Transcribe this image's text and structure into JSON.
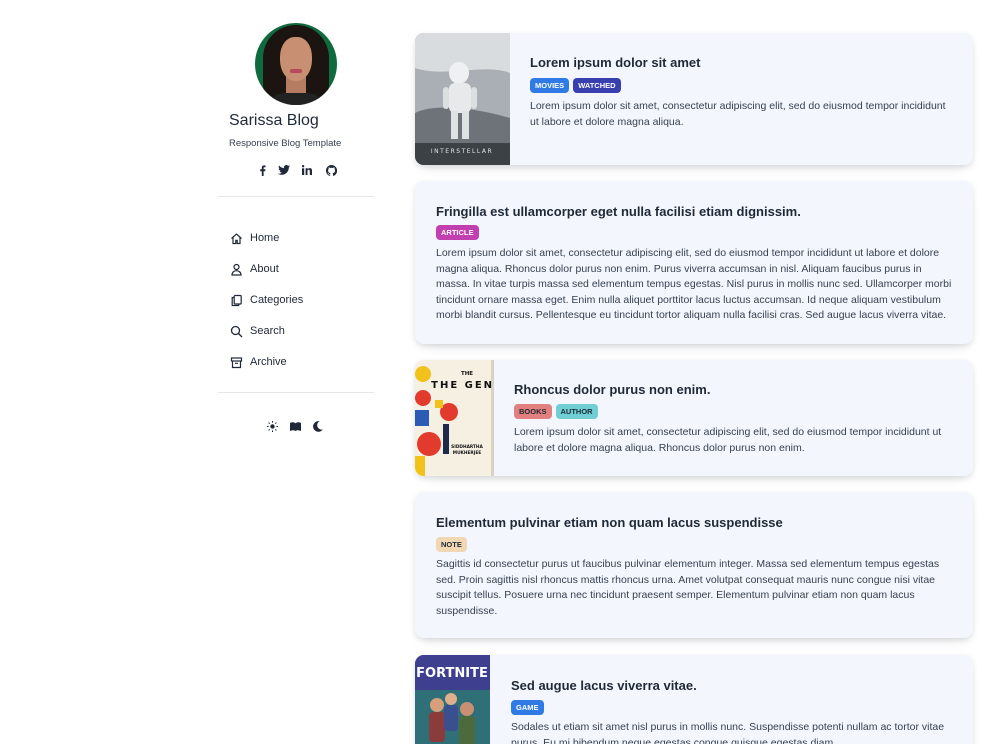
{
  "profile": {
    "name": "Sarissa Blog",
    "subtitle": "Responsive Blog Template",
    "avatar_icon": "person-avatar"
  },
  "socials": [
    {
      "name": "facebook-icon",
      "glyph": "f"
    },
    {
      "name": "twitter-icon",
      "glyph": "t"
    },
    {
      "name": "linkedin-icon",
      "glyph": "in"
    },
    {
      "name": "github-icon",
      "glyph": "gh"
    }
  ],
  "nav": {
    "items": [
      {
        "label": "Home",
        "icon": "home-icon"
      },
      {
        "label": "About",
        "icon": "user-icon"
      },
      {
        "label": "Categories",
        "icon": "copy-icon"
      },
      {
        "label": "Search",
        "icon": "search-icon"
      },
      {
        "label": "Archive",
        "icon": "archive-icon"
      }
    ]
  },
  "theme_switch": {
    "options": [
      "light-mode-icon",
      "reading-mode-icon",
      "dark-mode-icon"
    ]
  },
  "colors": {
    "card_bg": "#f3f6fd",
    "text": "#1f2937",
    "badge_movies": "#2f7ae5",
    "badge_watched": "#3a3fb0",
    "badge_article": "#c23fb0",
    "badge_books": "#e28080",
    "badge_author": "#6fcfd4",
    "badge_note": "#f2d7b5",
    "badge_game": "#2f7ae5"
  },
  "posts": [
    {
      "title": "Lorem ipsum dolor sit amet",
      "badges": [
        "MOVIES",
        "WATCHED"
      ],
      "text": "Lorem ipsum dolor sit amet, consectetur adipiscing elit, sed do eiusmod tempor incididunt ut labore et dolore magna aliqua.",
      "image_caption": "INTERSTELLAR"
    },
    {
      "title": "Fringilla est ullamcorper eget nulla facilisi etiam dignissim.",
      "badges": [
        "ARTICLE"
      ],
      "text": "Lorem ipsum dolor sit amet, consectetur adipiscing elit, sed do eiusmod tempor incididunt ut labore et dolore magna aliqua. Rhoncus dolor purus non enim. Purus viverra accumsan in nisl. Aliquam faucibus purus in massa. In vitae turpis massa sed elementum tempus egestas. Nisl purus in mollis nunc sed. Ullamcorper morbi tincidunt ornare massa eget. Enim nulla aliquet porttitor lacus luctus accumsan. Id neque aliquam vestibulum morbi blandit cursus. Pellentesque eu tincidunt tortor aliquam nulla facilisi cras. Sed augue lacus viverra vitae."
    },
    {
      "title": "Rhoncus dolor purus non enim.",
      "badges": [
        "BOOKS",
        "AUTHOR"
      ],
      "text": "Lorem ipsum dolor sit amet, consectetur adipiscing elit, sed do eiusmod tempor incididunt ut labore et dolore magna aliqua. Rhoncus dolor purus non enim.",
      "image_title": "THE GENE",
      "image_author": "SIDDHARTHA MUKHERJEE"
    },
    {
      "title": "Elementum pulvinar etiam non quam lacus suspendisse",
      "badges": [
        "NOTE"
      ],
      "text": "Sagittis id consectetur purus ut faucibus pulvinar elementum integer. Massa sed elementum tempus egestas sed. Proin sagittis nisl rhoncus mattis rhoncus urna. Amet volutpat consequat mauris nunc congue nisi vitae suscipit tellus. Posuere urna nec tincidunt praesent semper. Elementum pulvinar etiam non quam lacus suspendisse."
    },
    {
      "title": "Sed augue lacus viverra vitae.",
      "badges": [
        "GAME"
      ],
      "text": "Sodales ut etiam sit amet nisl purus in mollis nunc. Suspendisse potenti nullam ac tortor vitae purus. Eu mi bibendum neque egestas congue quisque egestas diam.",
      "image_title": "FORTNITE"
    }
  ]
}
